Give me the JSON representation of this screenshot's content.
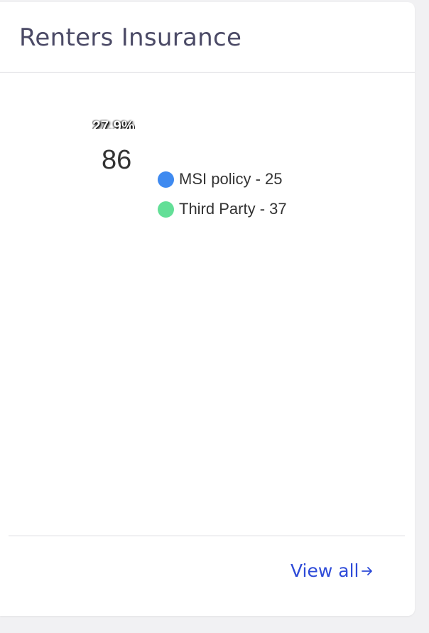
{
  "card": {
    "title": "Renters Insurance"
  },
  "chart_data": {
    "type": "pie",
    "total": "86",
    "visible_percent_label": "27.9%",
    "series": [
      {
        "name": "MSI policy",
        "value": 25,
        "color": "#3f8af0"
      },
      {
        "name": "Third Party",
        "value": 37,
        "color": "#63df97"
      },
      {
        "name": "",
        "value": null,
        "color": "#f5a623"
      }
    ],
    "legend_placement": "right"
  },
  "legend": {
    "items": [
      {
        "label": "MSI policy - 25",
        "color": "#3f8af0"
      },
      {
        "label": "Third Party - 37",
        "color": "#63df97"
      },
      {
        "label": "",
        "color": "#f5a623"
      }
    ]
  },
  "footer": {
    "view_all_label": "View all",
    "arrow_icon": "arrow-right-icon"
  },
  "colors": {
    "title": "#4b4a66",
    "link": "#2e4bd8"
  }
}
